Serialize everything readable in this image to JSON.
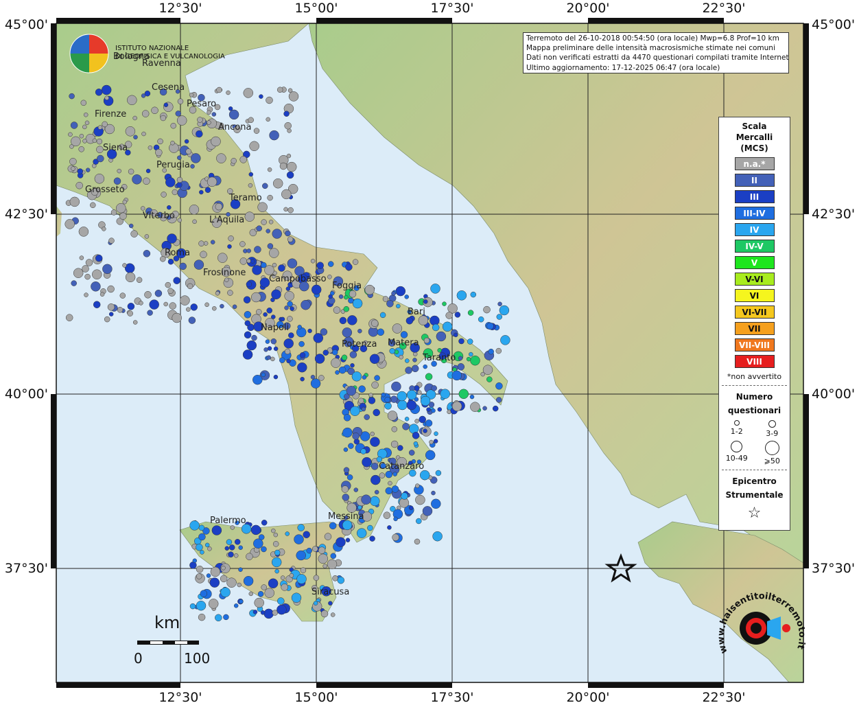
{
  "info": {
    "line1": "Terremoto del 26-10-2018 00:54:50 (ora locale) Mwp=6.8 Prof=10 km",
    "line2": "Mappa preliminare delle intensità macrosismiche stimate nei comuni",
    "line3": "Dati non verificati estratti da 4470 questionari compilati tramite Internet.",
    "line4": "Ultimo aggiornamento: 17-12-2025 06:47 (ora locale)"
  },
  "logo": {
    "line1": "ISTITUTO NAZIONALE",
    "line2": "DI GEOFISICA E VULCANOLOGIA"
  },
  "axes": {
    "lon_ticks": [
      "12°30'",
      "15°00'",
      "17°30'",
      "20°00'",
      "22°30'"
    ],
    "lat_ticks": [
      "45°00'",
      "42°30'",
      "40°00'",
      "37°30'"
    ]
  },
  "cities": [
    "Bologna",
    "Ravenna",
    "Cesena",
    "Pesaro",
    "Ancona",
    "Firenze",
    "Siena",
    "Perugia",
    "Grosseto",
    "Teramo",
    "Viterbo",
    "L'Aquila",
    "Roma",
    "Frosinone",
    "Campobasso",
    "Foggia",
    "Bari",
    "Napoli",
    "Potenza",
    "Matera",
    "Taranto",
    "Catanzaro",
    "Palermo",
    "Messina",
    "Siracusa"
  ],
  "legend": {
    "title": "Scala Mercalli (MCS)",
    "title_l1": "Scala",
    "title_l2": "Mercalli",
    "title_l3": "(MCS)",
    "classes": [
      {
        "label": "n.a.*",
        "color": "#a6a6a6"
      },
      {
        "label": "II",
        "color": "#4361b8"
      },
      {
        "label": "III",
        "color": "#1b3fc4"
      },
      {
        "label": "III-IV",
        "color": "#1f6ee0"
      },
      {
        "label": "IV",
        "color": "#2aa6ef"
      },
      {
        "label": "IV-V",
        "color": "#1ec864"
      },
      {
        "label": "V",
        "color": "#1ee61e"
      },
      {
        "label": "V-VI",
        "color": "#a8ec1e"
      },
      {
        "label": "VI",
        "color": "#f5f51e"
      },
      {
        "label": "VI-VII",
        "color": "#f5c81e"
      },
      {
        "label": "VII",
        "color": "#f5a01e"
      },
      {
        "label": "VII-VIII",
        "color": "#f0781e"
      },
      {
        "label": "VIII",
        "color": "#e61e1e"
      }
    ],
    "note": "*non avvertito",
    "count_title_l1": "Numero",
    "count_title_l2": "questionari",
    "counts": [
      "1-2",
      "3-9",
      "10-49",
      "⩾50"
    ],
    "epi_l1": "Epicentro",
    "epi_l2": "Strumentale"
  },
  "scale": {
    "unit": "km",
    "zero": "0",
    "hundred": "100"
  },
  "watermark": "www.haisentitoilterremoto.it",
  "map_data": {
    "epicenter": {
      "lon": 20.6,
      "lat": 37.35
    },
    "sea_color": "#dcecf8",
    "land_color": "#b6d39a"
  }
}
